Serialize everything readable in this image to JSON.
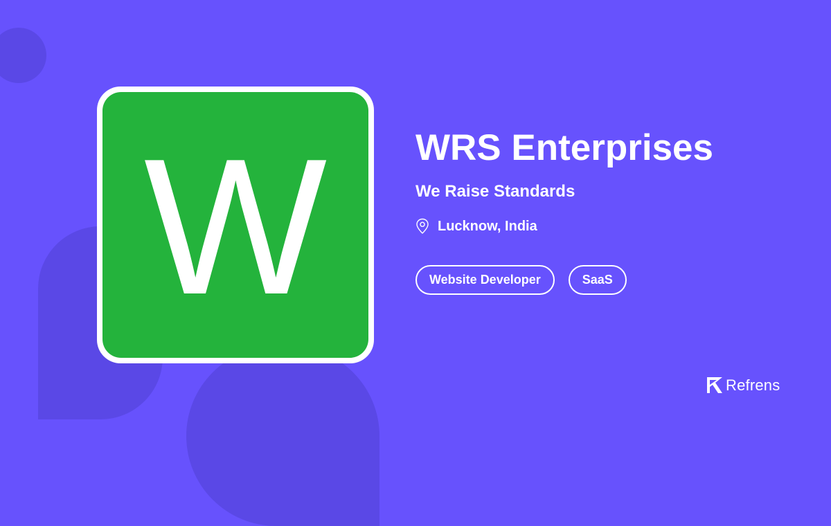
{
  "logo": {
    "letter": "W",
    "tile_color": "#24B33C",
    "frame_color": "#FFFFFF"
  },
  "company": {
    "name": "WRS Enterprises",
    "tagline": "We Raise Standards",
    "location": "Lucknow, India"
  },
  "tags": [
    {
      "label": "Website Developer"
    },
    {
      "label": "SaaS"
    }
  ],
  "brand": {
    "name": "Refrens",
    "icon": "refrens-logo-icon"
  },
  "icons": {
    "location": "map-pin-icon"
  },
  "colors": {
    "background": "#6752FD",
    "decoration": "#5A48E6",
    "text": "#FFFFFF"
  }
}
